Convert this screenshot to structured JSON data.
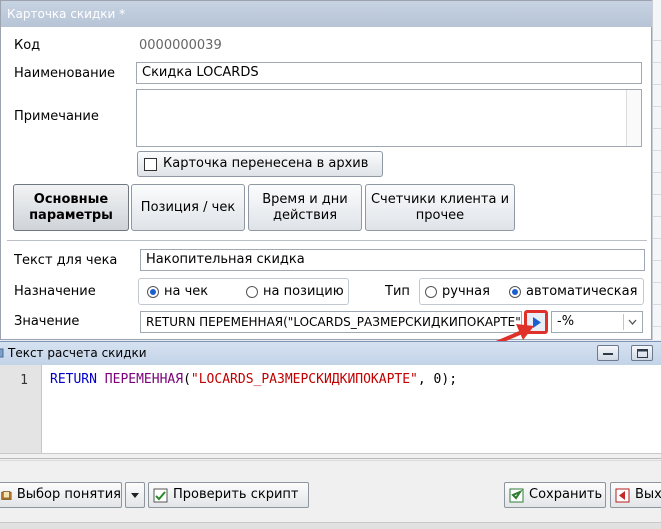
{
  "card": {
    "title": "Карточка скидки *",
    "code_label": "Код",
    "code_value": "0000000039",
    "name_label": "Наименование",
    "name_value": "Скидка LOCARDS",
    "note_label": "Примечание",
    "note_value": "",
    "archive_label": "Карточка перенесена в архив",
    "archive_checked": false,
    "tabs": [
      {
        "label": "Основные параметры",
        "active": true
      },
      {
        "label": "Позиция / чек",
        "active": false
      },
      {
        "label": "Время и дни действия",
        "active": false
      },
      {
        "label": "Счетчики клиента и прочее",
        "active": false
      }
    ],
    "receipt_text_label": "Текст для чека",
    "receipt_text_value": "Накопительная скидка",
    "purpose_label": "Назначение",
    "purpose_options": [
      "на чек",
      "на позицию"
    ],
    "purpose_selected": "на чек",
    "type_label": "Тип",
    "type_options": [
      "ручная",
      "автоматическая"
    ],
    "type_selected": "автоматическая",
    "value_label": "Значение",
    "value_formula": "RETURN ПЕРЕМЕННАЯ(\"LOCARDS_РАЗМЕРСКИДКИПОКАРТЕ\"",
    "value_unit": "-%"
  },
  "script_window": {
    "title": "Текст расчета скидки",
    "line_number": "1",
    "code": {
      "keyword": "RETURN",
      "function": "ПЕРЕМЕННАЯ",
      "open": "(",
      "string": "\"LOCARDS_РАЗМЕРСКИДКИПОКАРТЕ\"",
      "rest": ", 0);"
    },
    "buttons": {
      "choose_concept": "Выбор понятия",
      "check_script": "Проверить скрипт",
      "save": "Сохранить",
      "exit": "Вых"
    }
  },
  "colors": {
    "accent_red": "#e0302a",
    "keyword_blue": "#0000c8",
    "function_purple": "#7b007b",
    "string_red": "#c00000",
    "play_blue": "#1a5fd1"
  }
}
